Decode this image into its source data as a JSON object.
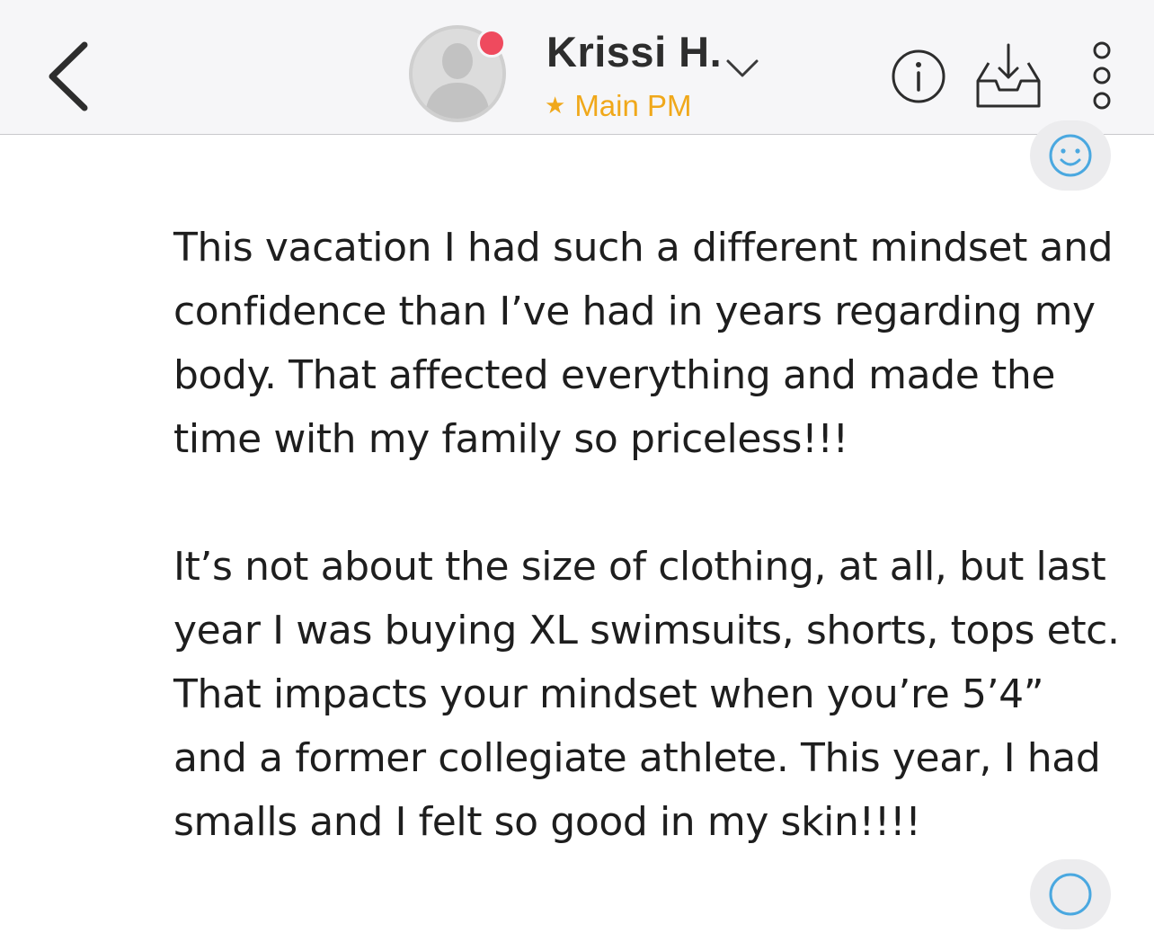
{
  "header": {
    "contact_name": "Krissi H.",
    "folder_label": "Main PM",
    "icons": {
      "back": "chevron-left-icon",
      "avatar": "default-user-avatar",
      "presence": "unread-dot",
      "dropdown": "chevron-down-icon",
      "info": "info-icon",
      "archive": "inbox-download-icon",
      "more": "vertical-dots-icon",
      "star": "star-icon",
      "emoji": "smiley-icon"
    },
    "colors": {
      "star": "#f0a81a",
      "presence_dot": "#ef4a5e",
      "emoji": "#4aa8e0"
    },
    "star_glyph": "★"
  },
  "message": {
    "paragraphs": [
      [
        "This vacation I had such a different mindset and",
        "confidence than I’ve had in years regarding my",
        "body. That affected everything and made the",
        "time with my family so priceless!!!"
      ],
      [
        "It’s not about the size of clothing, at all, but last",
        "year I was buying XL swimsuits, shorts, tops etc.",
        "That impacts your mindset when you’re 5’4”",
        "and a former collegiate athlete. This year, I had",
        "smalls and I felt so good in my skin!!!!"
      ]
    ]
  }
}
